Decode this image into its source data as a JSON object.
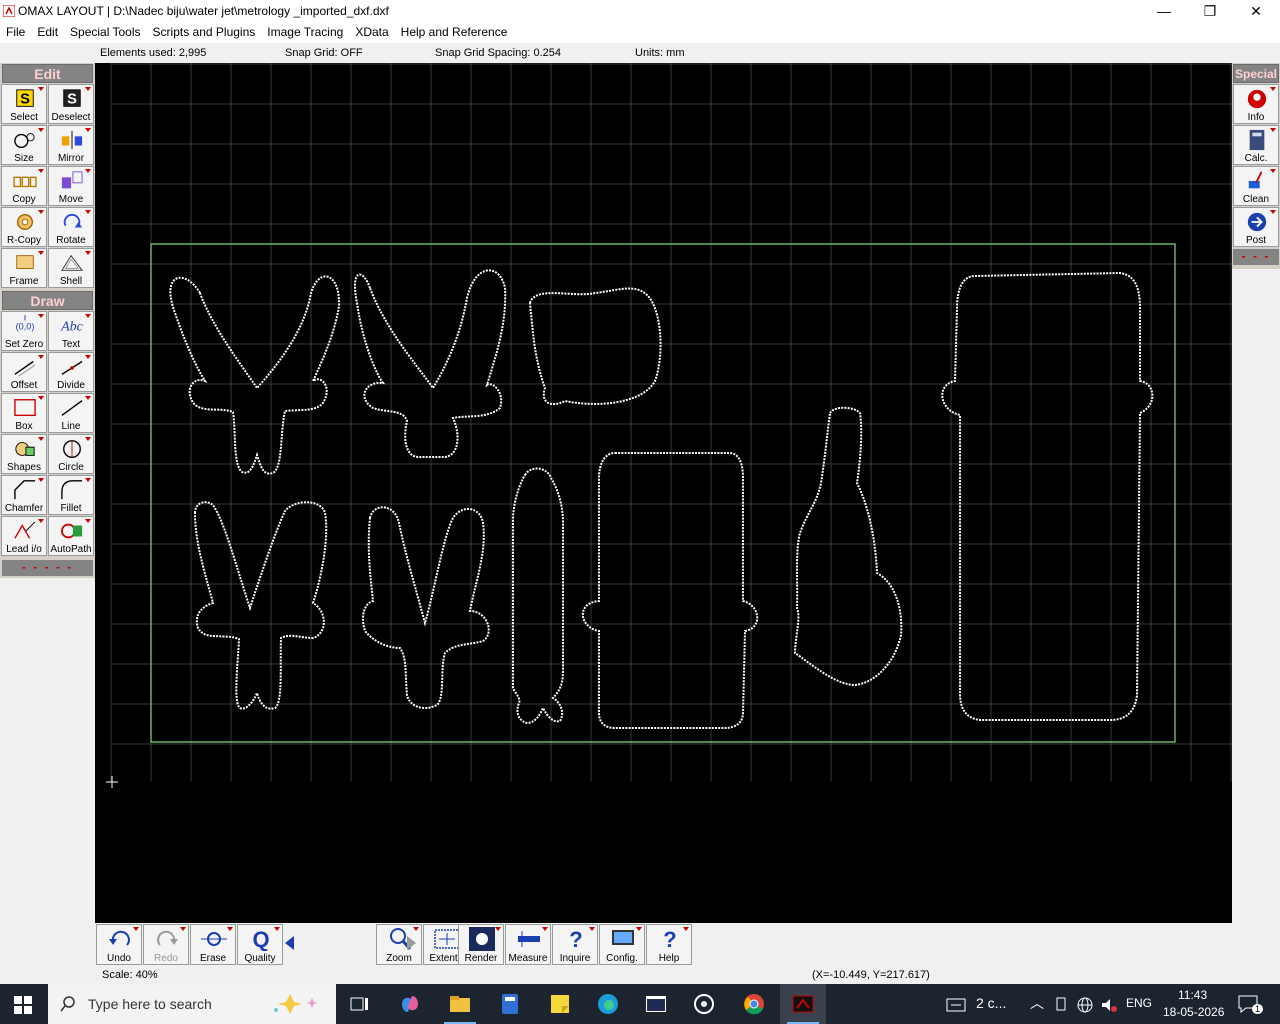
{
  "window": {
    "title": "OMAX LAYOUT | D:\\Nadec biju\\water jet\\metrology _imported_dxf.dxf",
    "minimize": "—",
    "restore": "❐",
    "close": "✕"
  },
  "menu": [
    "File",
    "Edit",
    "Special Tools",
    "Scripts and Plugins",
    "Image Tracing",
    "XData",
    "Help and Reference"
  ],
  "info": {
    "elements": "Elements used: 2,995",
    "snap_grid": "Snap Grid: OFF",
    "snap_spacing": "Snap Grid Spacing: 0.254",
    "units": "Units: mm"
  },
  "left_panel": {
    "edit_header": "Edit",
    "draw_header": "Draw",
    "edit_tools": [
      {
        "label": "Select",
        "icon": "select-icon"
      },
      {
        "label": "Deselect",
        "icon": "deselect-icon"
      },
      {
        "label": "Size",
        "icon": "size-icon"
      },
      {
        "label": "Mirror",
        "icon": "mirror-icon"
      },
      {
        "label": "Copy",
        "icon": "copy-icon"
      },
      {
        "label": "Move",
        "icon": "move-icon"
      },
      {
        "label": "R-Copy",
        "icon": "rotary-copy-icon"
      },
      {
        "label": "Rotate",
        "icon": "rotate-icon"
      },
      {
        "label": "Frame",
        "icon": "frame-icon"
      },
      {
        "label": "Shell",
        "icon": "shell-icon"
      }
    ],
    "draw_tools": [
      {
        "label": "Set Zero",
        "icon": "set-zero-icon",
        "glyph": "(0,0)"
      },
      {
        "label": "Text",
        "icon": "text-icon",
        "glyph": "Abc"
      },
      {
        "label": "Offset",
        "icon": "offset-icon"
      },
      {
        "label": "Divide",
        "icon": "divide-icon"
      },
      {
        "label": "Box",
        "icon": "box-icon"
      },
      {
        "label": "Line",
        "icon": "line-icon"
      },
      {
        "label": "Shapes",
        "icon": "shapes-icon"
      },
      {
        "label": "Circle",
        "icon": "circle-icon"
      },
      {
        "label": "Chamfer",
        "icon": "chamfer-icon"
      },
      {
        "label": "Fillet",
        "icon": "fillet-icon"
      },
      {
        "label": "Lead i/o",
        "icon": "lead-io-icon"
      },
      {
        "label": "AutoPath",
        "icon": "autopath-icon"
      }
    ],
    "more": "- - - - -"
  },
  "right_panel": {
    "header": "Special",
    "tools": [
      {
        "label": "Info",
        "icon": "info-icon"
      },
      {
        "label": "Calc.",
        "icon": "calculator-icon"
      },
      {
        "label": "Clean",
        "icon": "clean-icon"
      },
      {
        "label": "Post",
        "icon": "post-icon"
      }
    ],
    "more": "- - -"
  },
  "bottom_tools": [
    {
      "label": "Undo",
      "icon": "undo-icon",
      "enabled": true
    },
    {
      "label": "Redo",
      "icon": "redo-icon",
      "enabled": false
    },
    {
      "label": "Erase",
      "icon": "erase-icon",
      "enabled": true
    },
    {
      "label": "Quality",
      "icon": "quality-icon",
      "enabled": true
    },
    {
      "label": "Zoom",
      "icon": "zoom-icon",
      "enabled": true
    },
    {
      "label": "Extents",
      "icon": "extents-icon",
      "enabled": true
    },
    {
      "label": "Render",
      "icon": "render-icon",
      "enabled": true
    },
    {
      "label": "Measure",
      "icon": "measure-icon",
      "enabled": true
    },
    {
      "label": "Inquire",
      "icon": "inquire-icon",
      "enabled": true
    },
    {
      "label": "Config.",
      "icon": "config-icon",
      "enabled": true
    },
    {
      "label": "Help",
      "icon": "help-icon",
      "enabled": true
    }
  ],
  "status": {
    "scale": "Scale: 40%",
    "coords": "(X=-10.449, Y=217.617)"
  },
  "taskbar": {
    "search_placeholder": "Type here to search",
    "app_group": "2 c...",
    "language": "ENG",
    "time": "11:43",
    "date": "18-05-2026",
    "notifications": "1"
  },
  "colors": {
    "canvas": "#000000",
    "grid": "#3a3a3a",
    "frame": "#7fe07f",
    "part_outline": "#ffffff",
    "group_header": "#848484"
  }
}
